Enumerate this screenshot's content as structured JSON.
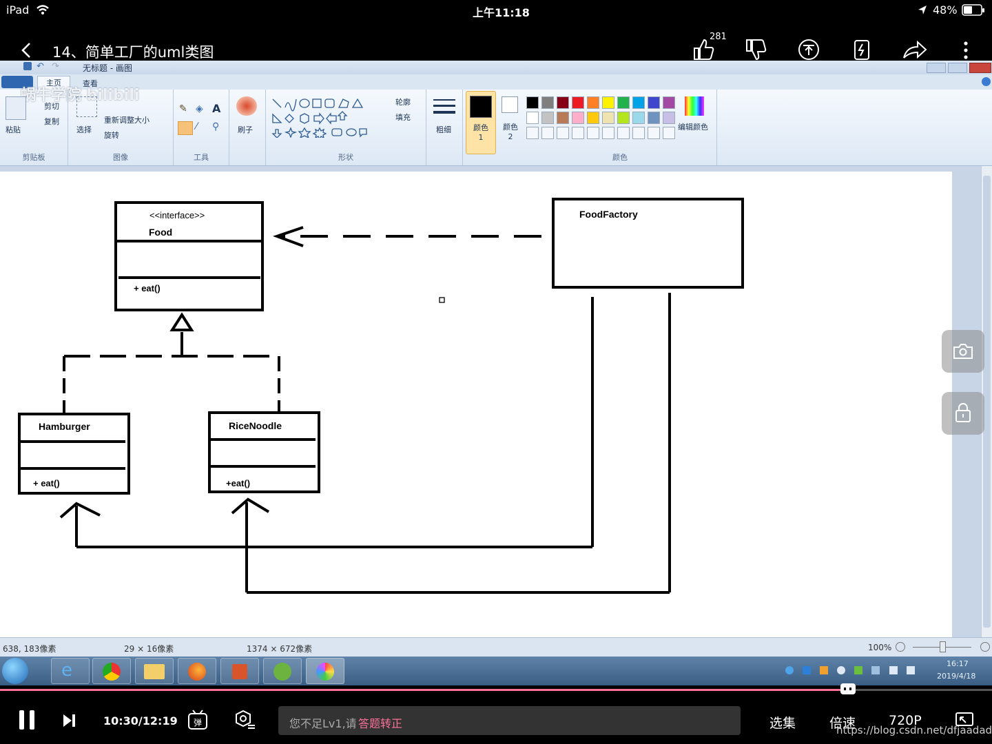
{
  "status_bar": {
    "device": "iPad",
    "time": "上午11:18",
    "battery": "48%"
  },
  "video": {
    "title": "14、简单工厂的uml类图",
    "like_count": "281"
  },
  "paint": {
    "window_title": "无标题 - 画图",
    "tabs": [
      "主页",
      "查看"
    ],
    "groups": {
      "clipboard": {
        "label": "剪贴板",
        "paste": "粘贴",
        "cut": "剪切",
        "copy": "复制"
      },
      "image": {
        "label": "图像",
        "select": "选择",
        "resize": "重新调整大小",
        "rotate": "旋转"
      },
      "tools": {
        "label": "工具"
      },
      "brush": {
        "label": "刷子"
      },
      "shapes": {
        "label": "形状",
        "outline": "轮廓",
        "fill": "填充"
      },
      "size": {
        "label": "粗细"
      },
      "color1": {
        "label": "颜色 1"
      },
      "color2": {
        "label": "颜色 2"
      },
      "colors": {
        "label": "颜色",
        "edit": "编辑颜色"
      }
    },
    "palette_row1": [
      "#000000",
      "#7f7f7f",
      "#880015",
      "#ed1c24",
      "#ff7f27",
      "#fff200",
      "#22b14c",
      "#00a2e8",
      "#3f48cc",
      "#a349a4"
    ],
    "palette_row2": [
      "#ffffff",
      "#c3c3c3",
      "#b97a57",
      "#ffaec9",
      "#ffc90e",
      "#efe4b0",
      "#b5e61d",
      "#99d9ea",
      "#7092be",
      "#c8bfe7"
    ],
    "status": {
      "cursor": "638, 183像素",
      "selection": "29 × 16像素",
      "canvas_size": "1374 × 672像素",
      "zoom": "100%"
    },
    "watermark": "蜗牛学院 bilibili"
  },
  "diagram": {
    "food": {
      "stereotype": "<<interface>>",
      "name": "Food",
      "method": "+ eat()"
    },
    "factory": {
      "name": "FoodFactory"
    },
    "hamburger": {
      "name": "Hamburger",
      "method": "+ eat()"
    },
    "ricenoodle": {
      "name": "RiceNoodle",
      "method": "+eat()"
    }
  },
  "taskbar": {
    "time": "16:17",
    "date": "2019/4/18"
  },
  "player": {
    "time": "10:30/12:19",
    "danmaku_placeholder": "您不足Lv1,请",
    "danmaku_link": "答题转正",
    "episodes": "选集",
    "speed": "倍速",
    "quality": "720P",
    "progress": 0.855,
    "watermark_url": "https://blog.csdn.net/dfjaadada"
  }
}
